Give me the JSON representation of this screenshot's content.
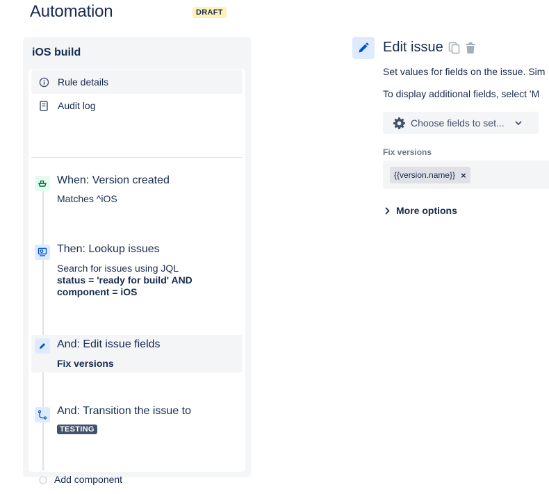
{
  "header": {
    "title": "Automation",
    "badge": "DRAFT"
  },
  "rule": {
    "name": "iOS build",
    "nav": [
      {
        "label": "Rule details",
        "icon": "info-icon"
      },
      {
        "label": "Audit log",
        "icon": "document-icon"
      }
    ],
    "steps": [
      {
        "title": "When: Version created",
        "sub": "Matches ^iOS",
        "icon": "ship-icon",
        "icon_color": "#006644",
        "icon_bg": "#e3fcef"
      },
      {
        "title": "Then: Lookup issues",
        "sub": "Search for issues using JQL",
        "sub_bold_1": "status = 'ready for build' AND",
        "sub_bold_2": "component = iOS",
        "icon": "search-issues-icon",
        "icon_color": "#0052cc",
        "icon_bg": "#deebff"
      },
      {
        "title": "And: Edit issue fields",
        "sub_bold": "Fix versions",
        "icon": "pencil-icon",
        "icon_color": "#0052cc",
        "icon_bg": "#deebff"
      },
      {
        "title": "And: Transition the issue to",
        "status": "TESTING",
        "icon": "transition-icon",
        "icon_color": "#0052cc",
        "icon_bg": "#deebff"
      }
    ],
    "add_component": "Add component"
  },
  "editor": {
    "title": "Edit issue",
    "desc_1": "Set values for fields on the issue. Sim",
    "desc_2": "To display additional fields, select 'M",
    "choose_button": "Choose fields to set...",
    "field_label": "Fix versions",
    "field_tag": "{{version.name}}",
    "tag_remove": "×",
    "more_options": "More options"
  },
  "colors": {
    "accent": "#0052cc",
    "selected_bg": "#deebff",
    "draft_bg": "#fff0b3",
    "lozenge_bg": "#42526e"
  }
}
